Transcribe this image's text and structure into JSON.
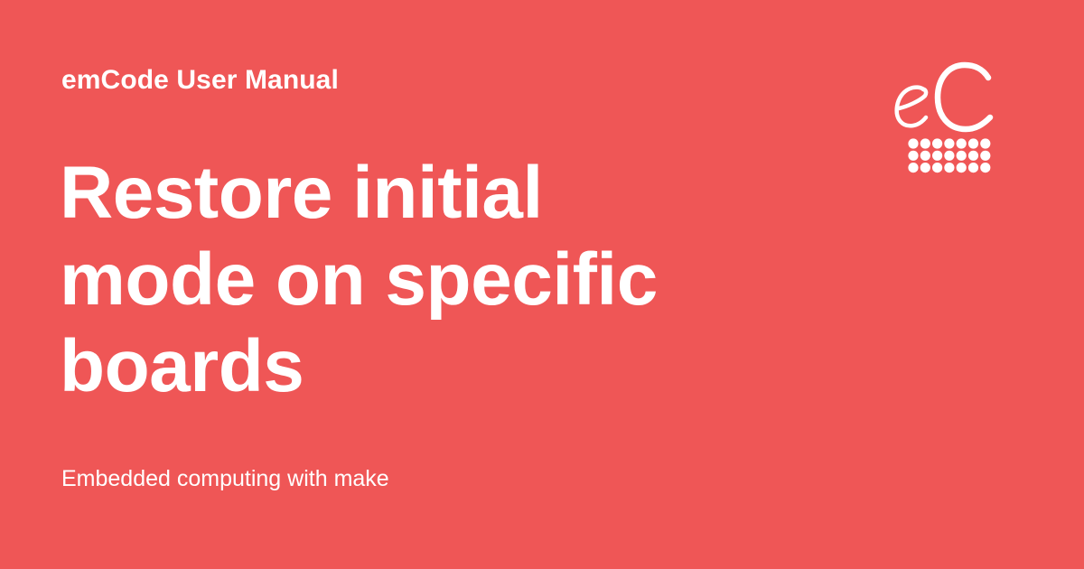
{
  "page": {
    "background_color": "#ef5656",
    "text_color": "#ffffff"
  },
  "header": {
    "overline": "emCode User Manual"
  },
  "main": {
    "title": "Restore initial mode on specific boards",
    "subtitle": "Embedded computing with make"
  },
  "logo": {
    "icon": "emcode-logo-icon",
    "mark_text": "eC"
  }
}
